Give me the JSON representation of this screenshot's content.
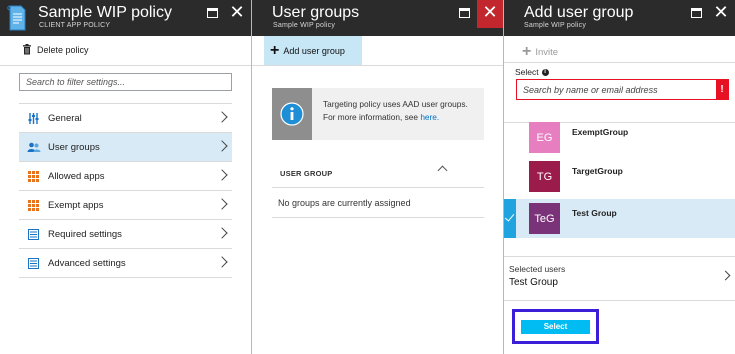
{
  "blade1": {
    "title": "Sample WIP policy",
    "subtitle": "CLIENT APP POLICY",
    "delete_label": "Delete policy",
    "search_placeholder": "Search to filter settings...",
    "menu": [
      {
        "label": "General",
        "icon": "sliders-icon",
        "selected": false
      },
      {
        "label": "User groups",
        "icon": "users-icon",
        "selected": true
      },
      {
        "label": "Allowed apps",
        "icon": "grid-apps-icon",
        "selected": false
      },
      {
        "label": "Exempt apps",
        "icon": "grid-apps-icon",
        "selected": false
      },
      {
        "label": "Required settings",
        "icon": "checklist-icon",
        "selected": false
      },
      {
        "label": "Advanced settings",
        "icon": "checklist-icon",
        "selected": false
      }
    ]
  },
  "blade2": {
    "title": "User groups",
    "subtitle": "Sample WIP policy",
    "add_label": "Add user group",
    "info_text": "Targeting policy uses AAD user groups. For more information, see",
    "info_link": "here.",
    "column_header": "USER GROUP",
    "empty_text": "No groups are currently assigned"
  },
  "blade3": {
    "title": "Add user group",
    "subtitle": "Sample WIP policy",
    "invite_label": "Invite",
    "select_label": "Select",
    "search_placeholder": "Search by name or email address",
    "error_badge": "!",
    "groups": [
      {
        "initials": "EG",
        "name": "ExemptGroup",
        "color": "#e67ec0",
        "selected": false
      },
      {
        "initials": "TG",
        "name": "TargetGroup",
        "color": "#9b1b4a",
        "selected": false
      },
      {
        "initials": "TeG",
        "name": "Test Group",
        "color": "#7a3278",
        "selected": true
      }
    ],
    "selected_users_label": "Selected users",
    "selected_users_value": "Test Group",
    "select_button": "Select"
  },
  "colors": {
    "header_bg": "#2b2b2b",
    "accent": "#00bcf2",
    "selection_bg": "#d8eaf5",
    "close_red": "#c1272d",
    "error_red": "#e81123",
    "highlight_outline": "#3a1ed8"
  }
}
